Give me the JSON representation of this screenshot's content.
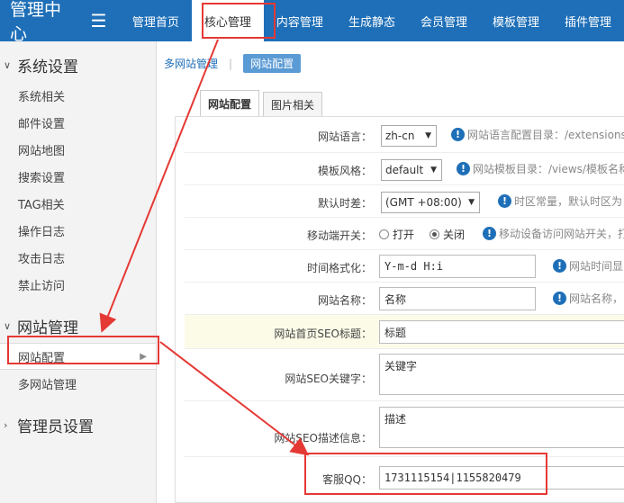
{
  "header": {
    "logo": "管理中心",
    "menu_icon": "☰",
    "nav": [
      "管理首页",
      "核心管理",
      "内容管理",
      "生成静态",
      "会员管理",
      "模板管理",
      "插件管理"
    ]
  },
  "sidebar": {
    "groups": [
      {
        "title": "系统设置",
        "items": [
          "系统相关",
          "邮件设置",
          "网站地图",
          "搜索设置",
          "TAG相关",
          "操作日志",
          "攻击日志",
          "禁止访问"
        ]
      },
      {
        "title": "网站管理",
        "items": [
          "网站配置",
          "多网站管理"
        ]
      },
      {
        "title": "管理员设置",
        "items": []
      }
    ]
  },
  "breadcrumb": {
    "parent": "多网站管理",
    "current": "网站配置"
  },
  "tabs": [
    "网站配置",
    "图片相关"
  ],
  "form": {
    "language": {
      "label": "网站语言：",
      "value": "zh-cn",
      "hint": "网站语言配置目录：/extensions/"
    },
    "template": {
      "label": "模板风格：",
      "value": "default",
      "hint": "网站模板目录：/views/模板名称"
    },
    "timezone": {
      "label": "默认时差：",
      "value": "(GMT +08:00)",
      "hint": "时区常量，默认时区为"
    },
    "mobile": {
      "label": "移动端开关：",
      "opt_on": "打开",
      "opt_off": "关闭",
      "hint": "移动设备访问网站开关，打"
    },
    "timeformat": {
      "label": "时间格式化：",
      "value": "Y-m-d H:i",
      "hint": "网站时间显"
    },
    "sitename": {
      "label": "网站名称：",
      "value": "名称",
      "hint": "网站名称，"
    },
    "seo_title": {
      "label": "网站首页SEO标题：",
      "value": "标题"
    },
    "seo_keywords": {
      "label": "网站SEO关键字：",
      "value": "关键字"
    },
    "seo_desc": {
      "label": "网站SEO描述信息：",
      "value": "描述"
    },
    "qq": {
      "label": "客服QQ：",
      "value": "1731115154|1155820479"
    }
  },
  "colors": {
    "header_bg": "#1e6fb8",
    "annotation": "#e53935",
    "accent": "#5b9bd5"
  }
}
